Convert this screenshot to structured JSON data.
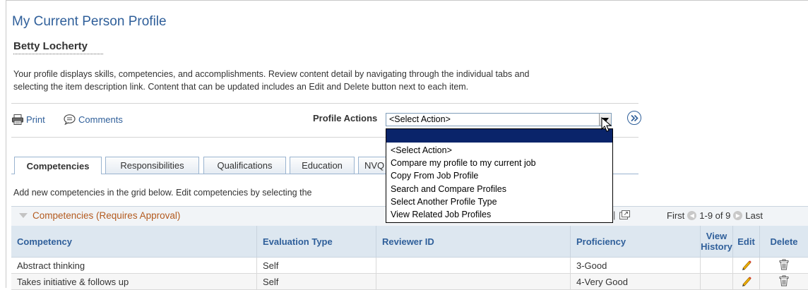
{
  "page": {
    "title": "My Current Person Profile",
    "person_name": "Betty Locherty",
    "intro_line1": "Your profile displays skills, competencies, and accomplishments. Review content detail by navigating through the individual tabs and",
    "intro_line2": "selecting the item description link. Content that can be updated includes an Edit and Delete button next to each item."
  },
  "toolbar": {
    "print_label": "Print",
    "comments_label": "Comments",
    "profile_actions_label": "Profile Actions",
    "select_value": "<Select Action>",
    "go_icon": "double-chevron-right-icon"
  },
  "dropdown": {
    "options": [
      "<Select Action>",
      "Compare my profile to my current job",
      "Copy From Job Profile",
      "Search and Compare Profiles",
      "Select Another Profile Type",
      "View Related Job Profiles"
    ]
  },
  "tabs": [
    {
      "label": "Competencies",
      "active": true
    },
    {
      "label": "Responsibilities"
    },
    {
      "label": "Qualifications"
    },
    {
      "label": "Education"
    },
    {
      "label": "NVQ"
    }
  ],
  "grid": {
    "note": "Add new competencies in the grid below. Edit competencies by selecting the",
    "title": "Competencies (Requires Approval)",
    "separator": "|",
    "pager": {
      "first": "First",
      "range": "1-9 of 9",
      "last": "Last"
    },
    "columns": {
      "competency": "Competency",
      "evaluation_type": "Evaluation Type",
      "reviewer_id": "Reviewer ID",
      "proficiency": "Proficiency",
      "view_history_1": "View",
      "view_history_2": "History",
      "edit": "Edit",
      "delete": "Delete"
    },
    "rows": [
      {
        "competency": "Abstract thinking",
        "evaluation_type": "Self",
        "reviewer_id": "",
        "proficiency": "3-Good"
      },
      {
        "competency": "Takes initiative & follows up",
        "evaluation_type": "Self",
        "reviewer_id": "",
        "proficiency": "4-Very Good"
      }
    ]
  },
  "colors": {
    "title": "#2f5f9a",
    "link": "#2f5f9a",
    "grid_title": "#b35a1f",
    "dropdown_highlight": "#0a246a"
  }
}
